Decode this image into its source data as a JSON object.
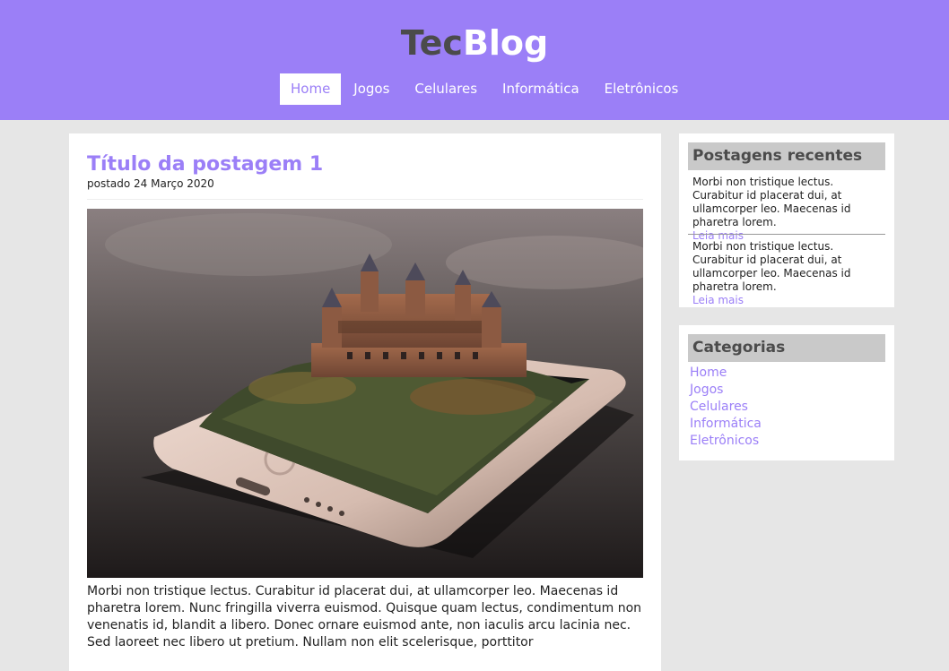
{
  "header": {
    "logo_part1": "Tec",
    "logo_part2": "Blog",
    "nav": [
      "Home",
      "Jogos",
      "Celulares",
      "Informática",
      "Eletrônicos"
    ]
  },
  "post": {
    "title": "Título da postagem 1",
    "date": "postado 24 Março 2020",
    "body": "Morbi non tristique lectus. Curabitur id placerat dui, at ullamcorper leo. Maecenas id pharetra lorem. Nunc fringilla viverra euismod. Quisque quam lectus, condimentum non venenatis id, blandit a libero. Donec ornare euismod ante, non iaculis arcu lacinia nec. Sed laoreet nec libero ut pretium. Nullam non elit scelerisque, porttitor"
  },
  "sidebar": {
    "recent": {
      "title": "Postagens recentes",
      "items": [
        {
          "text": "Morbi non tristique lectus. Curabitur id placerat dui, at ullamcorper leo. Maecenas id pharetra lorem.",
          "link": "Leia mais"
        },
        {
          "text": "Morbi non tristique lectus. Curabitur id placerat dui, at ullamcorper leo. Maecenas id pharetra lorem.",
          "link": "Leia mais"
        }
      ]
    },
    "categories": {
      "title": "Categorias",
      "items": [
        "Home",
        "Jogos",
        "Celulares",
        "Informática",
        "Eletrônicos"
      ]
    }
  },
  "colors": {
    "accent": "#9b7ff7",
    "background": "#e6e6e6",
    "widget_title_bg": "#c9c9c9"
  }
}
